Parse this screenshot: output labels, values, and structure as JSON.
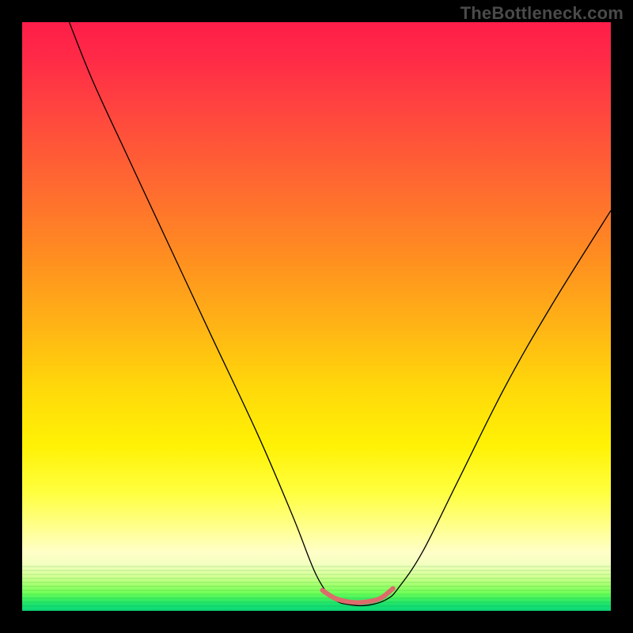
{
  "watermark": "TheBottleneck.com",
  "chart_data": {
    "type": "line",
    "title": "",
    "xlabel": "",
    "ylabel": "",
    "xlim": [
      0,
      100
    ],
    "ylim": [
      0,
      100
    ],
    "grid": false,
    "legend": false,
    "series": [
      {
        "name": "bottleneck-curve",
        "x": [
          8,
          12,
          18,
          25,
          32,
          40,
          46,
          50,
          53,
          56,
          59,
          62,
          64,
          68,
          74,
          82,
          90,
          100
        ],
        "values": [
          100,
          90,
          77,
          62,
          47,
          30,
          16,
          6,
          2,
          1,
          1,
          2,
          4,
          10,
          22,
          38,
          52,
          68
        ],
        "color": "#000000"
      },
      {
        "name": "optimal-band",
        "x": [
          51,
          53,
          55,
          57,
          59,
          61,
          63
        ],
        "values": [
          3.5,
          2.2,
          1.6,
          1.4,
          1.6,
          2.2,
          3.8
        ],
        "color": "#dd6b6b"
      }
    ],
    "background_gradient": {
      "orientation": "vertical",
      "stops": [
        {
          "pos": 0.0,
          "color": "#ff1d49"
        },
        {
          "pos": 0.3,
          "color": "#ff7a28"
        },
        {
          "pos": 0.6,
          "color": "#ffd80a"
        },
        {
          "pos": 0.85,
          "color": "#ffff90"
        },
        {
          "pos": 1.0,
          "color": "#0cd87a"
        }
      ]
    }
  }
}
